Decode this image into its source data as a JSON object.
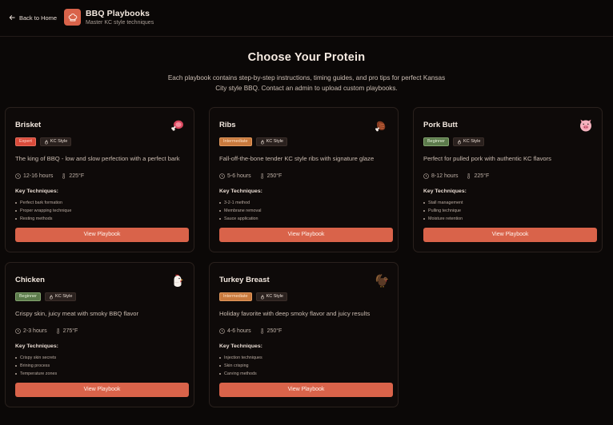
{
  "header": {
    "back_label": "Back to Home",
    "title": "BBQ Playbooks",
    "subtitle": "Master KC style techniques"
  },
  "hero": {
    "title": "Choose Your Protein",
    "description": "Each playbook contains step-by-step instructions, timing guides, and pro tips for perfect Kansas City style BBQ. Contact an admin to upload custom playbooks."
  },
  "colors": {
    "accent": "#d9634a",
    "background": "#0b0807",
    "expert": "#d94a3a",
    "intermediate": "#c8793d",
    "beginner": "#5b7a4b"
  },
  "common": {
    "style_badge": "KC Style",
    "techniques_heading": "Key Techniques:",
    "button_label": "View Playbook"
  },
  "cards": [
    {
      "title": "Brisket",
      "emoji_icon": "meat-on-bone-icon",
      "level": "Expert",
      "description": "The king of BBQ - low and slow perfection with a perfect bark",
      "time": "12-16 hours",
      "temp": "225°F",
      "techniques": [
        "Perfect bark formation",
        "Proper wrapping technique",
        "Resting methods"
      ]
    },
    {
      "title": "Ribs",
      "emoji_icon": "ribs-icon",
      "level": "Intermediate",
      "description": "Fall-off-the-bone tender KC style ribs with signature glaze",
      "time": "5-6 hours",
      "temp": "250°F",
      "techniques": [
        "3-2-1 method",
        "Membrane removal",
        "Sauce application"
      ]
    },
    {
      "title": "Pork Butt",
      "emoji_icon": "pig-face-icon",
      "level": "Beginner",
      "description": "Perfect for pulled pork with authentic KC flavors",
      "time": "8-12 hours",
      "temp": "225°F",
      "techniques": [
        "Stall management",
        "Pulling technique",
        "Moisture retention"
      ]
    },
    {
      "title": "Chicken",
      "emoji_icon": "chicken-icon",
      "level": "Beginner",
      "description": "Crispy skin, juicy meat with smoky BBQ flavor",
      "time": "2-3 hours",
      "temp": "275°F",
      "techniques": [
        "Crispy skin secrets",
        "Brining process",
        "Temperature zones"
      ]
    },
    {
      "title": "Turkey Breast",
      "emoji_icon": "turkey-icon",
      "level": "Intermediate",
      "description": "Holiday favorite with deep smoky flavor and juicy results",
      "time": "4-6 hours",
      "temp": "250°F",
      "techniques": [
        "Injection techniques",
        "Skin crisping",
        "Carving methods"
      ]
    }
  ]
}
